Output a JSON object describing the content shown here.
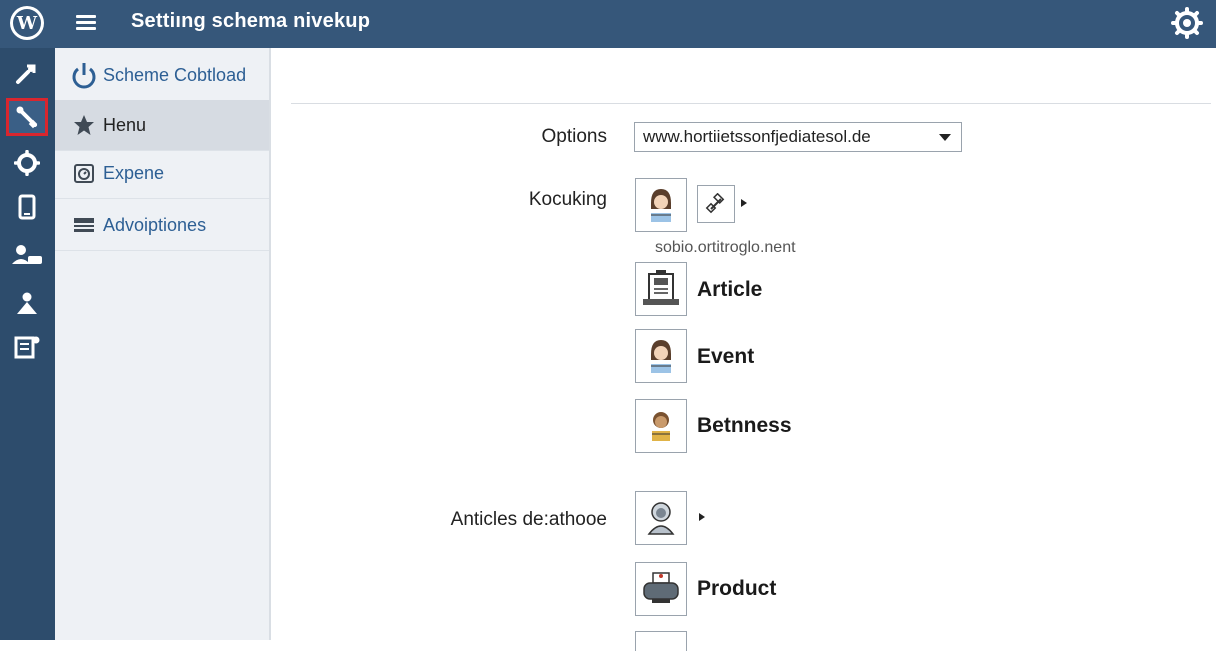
{
  "app": {
    "title": "Settiıng schema nivekup"
  },
  "rail": {
    "items": [
      {
        "icon": "tools-icon",
        "active": false
      },
      {
        "icon": "wrench-icon",
        "active": true
      },
      {
        "icon": "gear-icon",
        "active": false
      },
      {
        "icon": "tablet-icon",
        "active": false
      },
      {
        "icon": "users-icon",
        "active": false
      },
      {
        "icon": "person-icon",
        "active": false
      },
      {
        "icon": "widgets-icon",
        "active": false
      }
    ]
  },
  "sidebar": {
    "items": [
      {
        "label": "Scheme Cobtload",
        "icon": "power-icon"
      },
      {
        "label": "Henu",
        "icon": "star-icon",
        "selected": true
      },
      {
        "label": "Expene",
        "icon": "clock-icon"
      },
      {
        "label": "Advoiptiones",
        "icon": "layers-icon"
      }
    ]
  },
  "main": {
    "options_label": "Options",
    "options_value": "www.hortiietssonfjediatesol.de",
    "kocuking_label": "Kocuking",
    "url_text": "sobio.ortitroglo.nent",
    "schema_types": [
      {
        "label": "Article",
        "icon": "article-icon"
      },
      {
        "label": "Event",
        "icon": "event-icon"
      },
      {
        "label": "Betnness",
        "icon": "business-icon"
      }
    ],
    "articles_label": "Anticles de:athooe",
    "product_label": "Product"
  },
  "colors": {
    "topbar": "#36577a",
    "rail": "#2d4c6c",
    "sidebar": "#eef1f5",
    "link": "#2d5f94",
    "active_outline": "#d9262e"
  }
}
